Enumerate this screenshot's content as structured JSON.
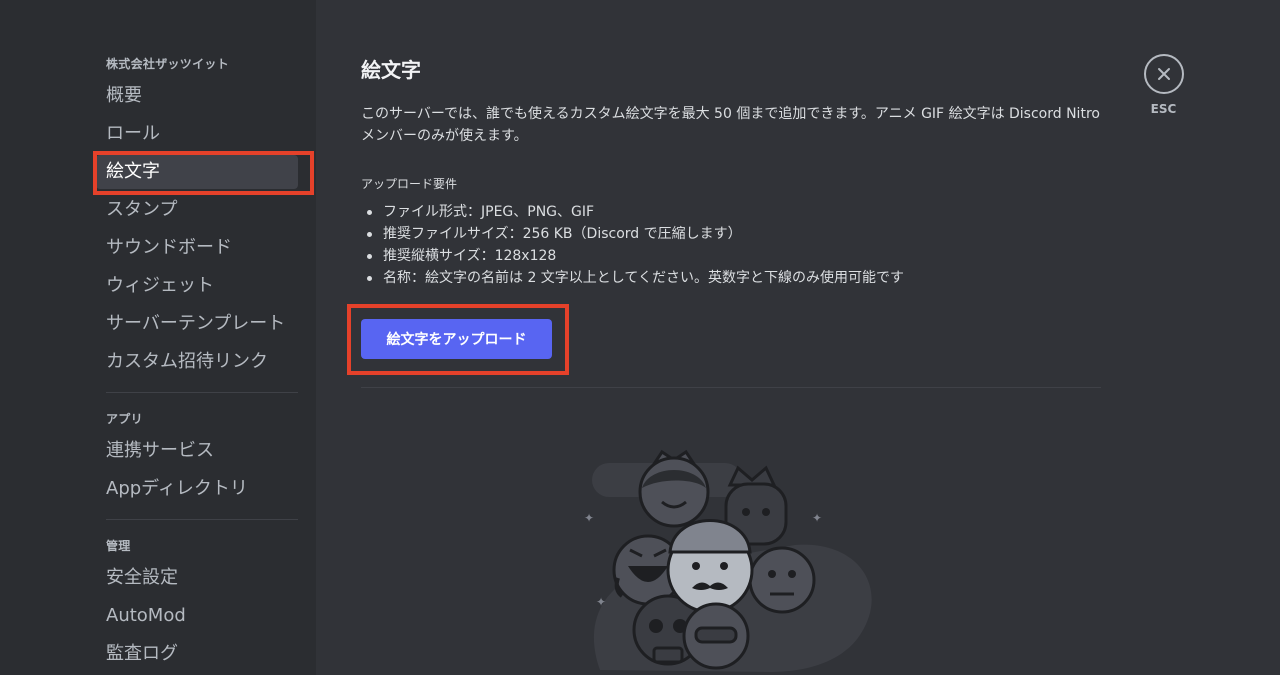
{
  "sidebar": {
    "server_section": "株式会社ザッツイット",
    "server_items": [
      {
        "label": "概要"
      },
      {
        "label": "ロール"
      },
      {
        "label": "絵文字"
      },
      {
        "label": "スタンプ"
      },
      {
        "label": "サウンドボード"
      },
      {
        "label": "ウィジェット"
      },
      {
        "label": "サーバーテンプレート"
      },
      {
        "label": "カスタム招待リンク"
      }
    ],
    "apps_section": "アプリ",
    "apps_items": [
      {
        "label": "連携サービス"
      },
      {
        "label": "Appディレクトリ"
      }
    ],
    "manage_section": "管理",
    "manage_items": [
      {
        "label": "安全設定"
      },
      {
        "label": "AutoMod"
      },
      {
        "label": "監査ログ"
      }
    ]
  },
  "main": {
    "title": "絵文字",
    "description": "このサーバーでは、誰でも使えるカスタム絵文字を最大 50 個まで追加できます。アニメ GIF 絵文字は Discord Nitro メンバーのみが使えます。",
    "requirements_header": "アップロード要件",
    "requirements": [
      "ファイル形式：JPEG、PNG、GIF",
      "推奨ファイルサイズ：256 KB（Discord で圧縮します）",
      "推奨縦横サイズ：128x128",
      "名称：絵文字の名前は 2 文字以上としてください。英数字と下線のみ使用可能です"
    ],
    "upload_button": "絵文字をアップロード"
  },
  "close": {
    "label": "ESC",
    "icon": "close-icon"
  },
  "colors": {
    "accent": "#5865f2",
    "highlight": "#e5412a",
    "sidebar_bg": "#2b2d31",
    "main_bg": "#313338"
  }
}
